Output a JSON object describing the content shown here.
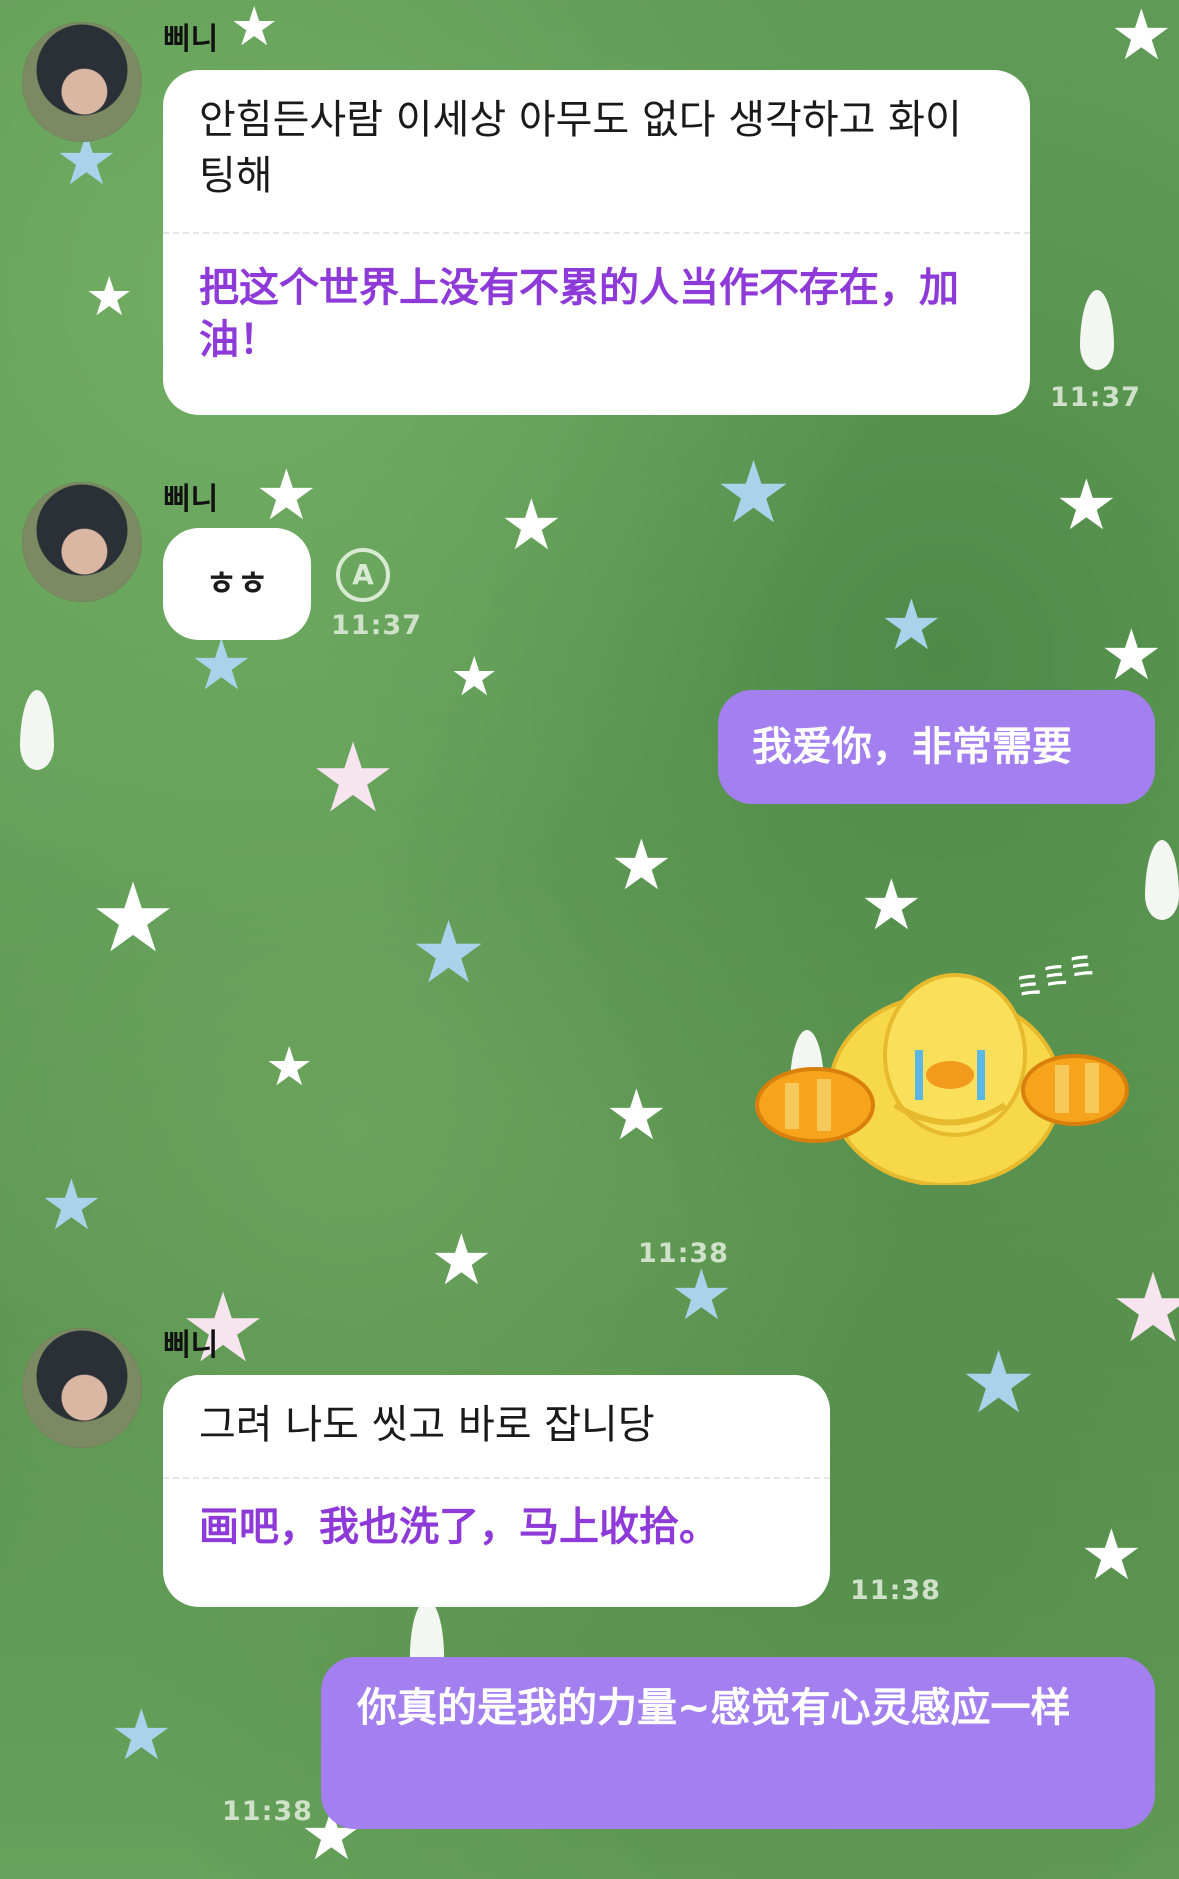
{
  "messages": {
    "m1": {
      "sender": "삐니",
      "original": "안힘든사람 이세상 아무도 없다 생각하고 화이팅해",
      "translation": "把这个世界上没有不累的人当作不存在，加油！",
      "time": "11:37"
    },
    "m2": {
      "sender": "삐니",
      "original": "ㅎㅎ",
      "time": "11:37",
      "translate_icon": "A"
    },
    "m3": {
      "text": "我爱你，非常需要"
    },
    "m4": {
      "sticker": "crying-duck-sticker",
      "sticker_text": "ミミミ",
      "time": "11:38"
    },
    "m5": {
      "sender": "삐니",
      "original": "그려 나도 씻고 바로 잡니당",
      "translation": "画吧，我也洗了，马上收拾。",
      "time": "11:38"
    },
    "m6": {
      "text": "你真的是我的力量~感觉有心灵感应一样",
      "time": "11:38"
    }
  },
  "colors": {
    "background": "#5e9a55",
    "my_bubble": "#a37ff0",
    "translation_text": "#8e3ad8"
  }
}
